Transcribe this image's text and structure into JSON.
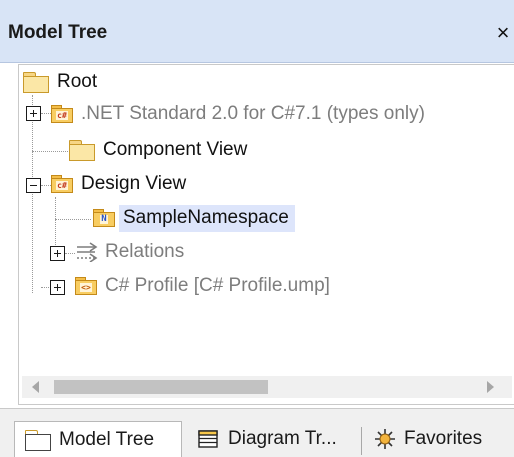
{
  "window": {
    "title": "Model Tree",
    "close_glyph": "×"
  },
  "tree": {
    "root": {
      "label": "Root",
      "icon": "folder-icon"
    },
    "items": [
      {
        "label": ".NET Standard 2.0 for C#7.1 (types only)",
        "icon": "csharp-package-icon",
        "expander": "plus",
        "style": "gray"
      },
      {
        "label": "Component View",
        "icon": "folder-icon",
        "expander": "none",
        "style": "normal"
      },
      {
        "label": "Design View",
        "icon": "csharp-package-icon",
        "expander": "minus",
        "style": "normal"
      },
      {
        "label": "SampleNamespace",
        "icon": "namespace-package-icon",
        "expander": "none",
        "style": "selected"
      },
      {
        "label": "Relations",
        "icon": "relations-icon",
        "expander": "plus",
        "style": "gray"
      },
      {
        "label": "C# Profile [C# Profile.ump]",
        "icon": "profile-package-icon",
        "expander": "plus",
        "style": "gray"
      }
    ],
    "badges": {
      "csharp": "c#",
      "namespace": "N",
      "profile": "<>"
    }
  },
  "tabs": [
    {
      "label": "Model Tree",
      "icon": "folder-icon",
      "active": true
    },
    {
      "label": "Diagram Tr...",
      "icon": "diagram-tree-icon",
      "active": false
    },
    {
      "label": "Favorites",
      "icon": "favorites-icon",
      "active": false
    }
  ],
  "colors": {
    "titlebar": "#d8e4f6",
    "selection": "#dde5fb",
    "folder": "#fbe7a6",
    "package": "#f8cd62"
  }
}
